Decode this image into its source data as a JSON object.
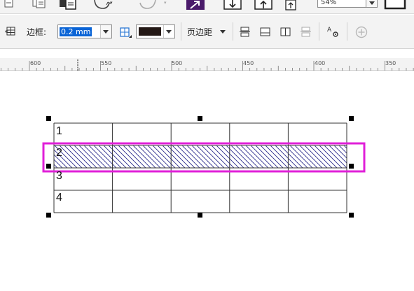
{
  "top_toolbar": {
    "zoom_value": "54%",
    "icons": [
      "new-document-icon",
      "open-icon",
      "save-icon",
      "undo-icon",
      "redo-icon",
      "search-icon",
      "import-icon",
      "export-icon",
      "publish-icon",
      "zoom-dropdown-icon",
      "full-screen-icon"
    ]
  },
  "property_bar": {
    "border_label": "边框:",
    "border_width_value": "0.2 mm",
    "border_color": "#231815",
    "margins_label": "页边距",
    "icons": [
      "table-options-icon",
      "border-select-icon",
      "align-top-icon",
      "align-middle-icon",
      "align-center-icon",
      "merge-cells-icon",
      "text-format-icon",
      "add-icon"
    ]
  },
  "ruler": {
    "labels": [
      "600",
      "550",
      "500",
      "450",
      "400",
      "350"
    ]
  },
  "canvas": {
    "table": {
      "rows": [
        {
          "label": "1"
        },
        {
          "label": "2",
          "selected": true,
          "fill_pattern": "diagonal-hatch"
        },
        {
          "label": "3"
        },
        {
          "label": "4"
        }
      ],
      "column_count": 5,
      "selection_color": "#e020d8",
      "hatch_color": "#2b2b8c"
    }
  }
}
